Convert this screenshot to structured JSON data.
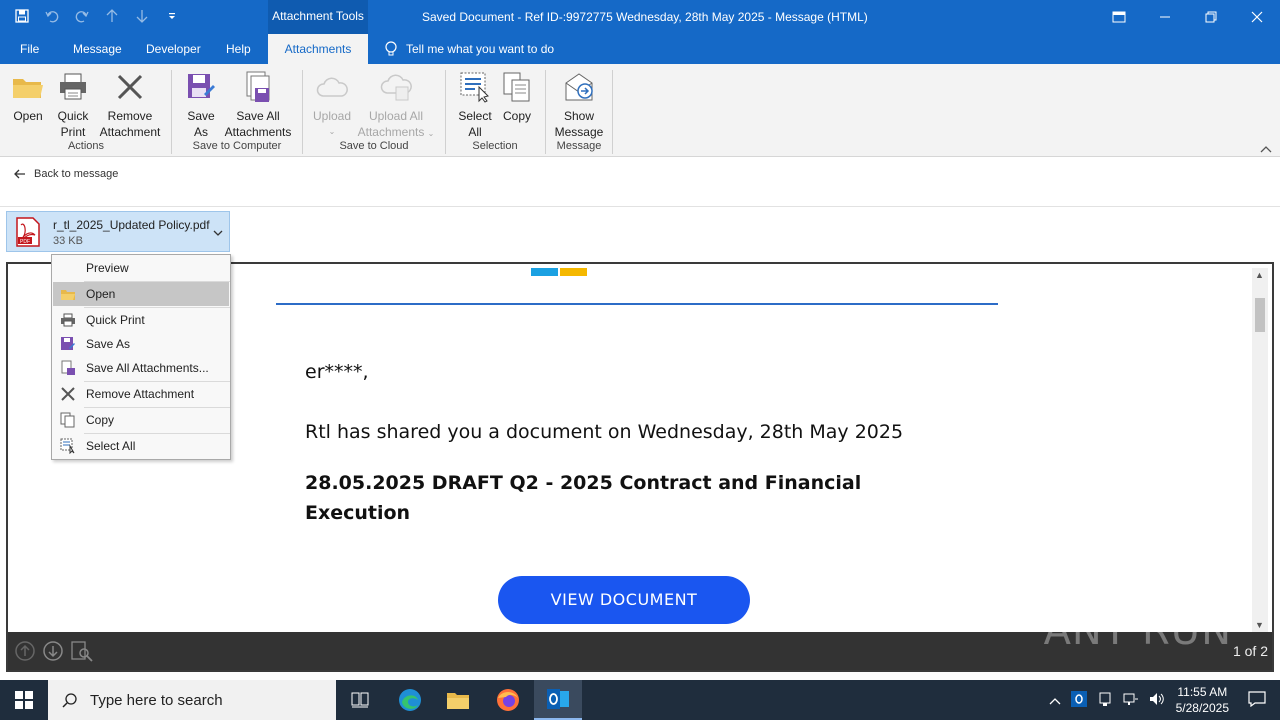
{
  "window": {
    "context_tab": "Attachment Tools",
    "title": "Saved Document - Ref ID-:9972775 Wednesday, 28th May 2025  -  Message (HTML)"
  },
  "tabs": [
    "File",
    "Message",
    "Developer",
    "Help",
    "Attachments"
  ],
  "tell_me": "Tell me what you want to do",
  "ribbon": {
    "actions": {
      "open": "Open",
      "quick_print_1": "Quick",
      "quick_print_2": "Print",
      "remove_1": "Remove",
      "remove_2": "Attachment",
      "group": "Actions"
    },
    "computer": {
      "save_as_1": "Save",
      "save_as_2": "As",
      "save_all_1": "Save All",
      "save_all_2": "Attachments",
      "group": "Save to Computer"
    },
    "cloud": {
      "upload": "Upload",
      "upload_all_1": "Upload All",
      "upload_all_2": "Attachments",
      "group": "Save to Cloud"
    },
    "selection": {
      "select_all_1": "Select",
      "select_all_2": "All",
      "copy": "Copy",
      "group": "Selection"
    },
    "message": {
      "show_1": "Show",
      "show_2": "Message",
      "group": "Message"
    }
  },
  "back_link": "Back to message",
  "attachment": {
    "name": "r_tl_2025_Updated Policy.pdf",
    "size": "33 KB"
  },
  "context_menu": [
    "Preview",
    "Open",
    "Quick Print",
    "Save As",
    "Save All Attachments...",
    "Remove Attachment",
    "Copy",
    "Select All"
  ],
  "document": {
    "greeting": "er****,",
    "shared_line": "Rtl has shared you a document on Wednesday, 28th May 2025",
    "heading": "28.05.2025 DRAFT Q2 - 2025 Contract and Financial Execution",
    "button": "VIEW  DOCUMENT",
    "page_indicator": "1 of 2",
    "watermark": "ANY RUN"
  },
  "colors": {
    "accent": "#1569c7",
    "doc_button": "#1a56f0",
    "logo_blue": "#1ba1e2",
    "logo_yellow": "#f5b800"
  },
  "taskbar": {
    "search_placeholder": "Type here to search",
    "time": "11:55 AM",
    "date": "5/28/2025"
  }
}
